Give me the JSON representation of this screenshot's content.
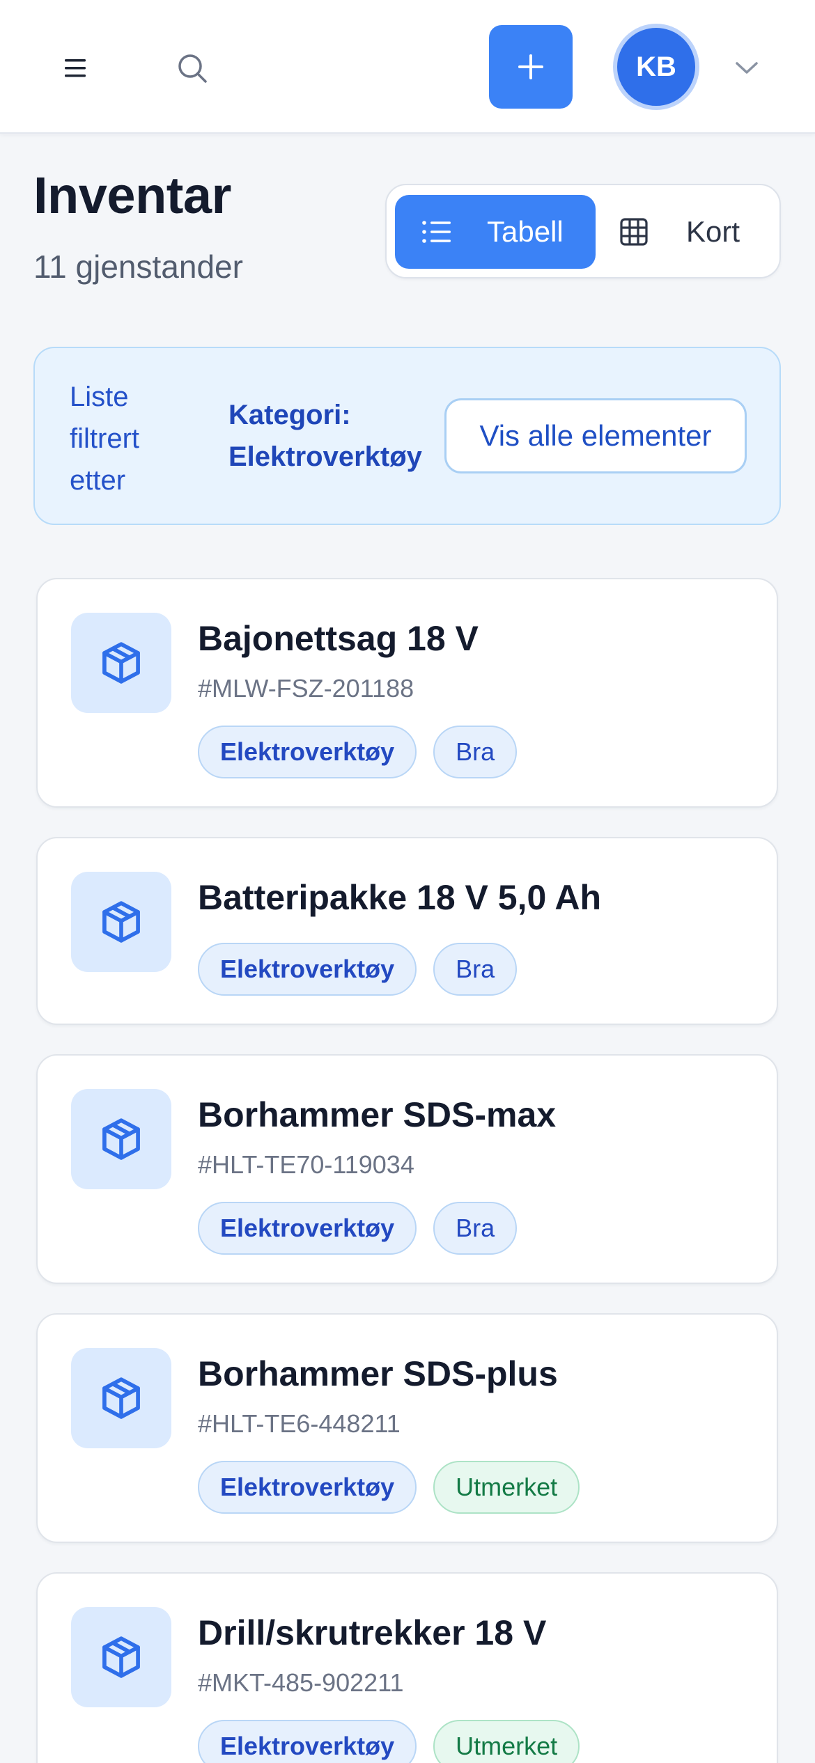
{
  "topbar": {
    "menu_icon": "hamburger-menu-icon",
    "search_icon": "search-icon",
    "add_icon": "plus-icon",
    "avatar_initials": "KB",
    "chevron_icon": "chevron-down-icon"
  },
  "header": {
    "title": "Inventar",
    "count_text": "11 gjenstander"
  },
  "view_toggle": {
    "table_label": "Tabell",
    "table_icon": "list-icon",
    "cards_label": "Kort",
    "cards_icon": "grid-icon",
    "active": "table"
  },
  "filter": {
    "prefix": "Liste filtrert etter",
    "value": "Kategori: Elektroverktøy",
    "show_all_label": "Vis alle elementer"
  },
  "items": [
    {
      "name": "Bajonettsag 18 V",
      "sku": "#MLW-FSZ-201188",
      "category": "Elektroverktøy",
      "condition": "Bra",
      "condition_style": "blue"
    },
    {
      "name": "Batteripakke 18 V 5,0 Ah",
      "sku": "",
      "category": "Elektroverktøy",
      "condition": "Bra",
      "condition_style": "blue"
    },
    {
      "name": "Borhammer SDS-max",
      "sku": "#HLT-TE70-119034",
      "category": "Elektroverktøy",
      "condition": "Bra",
      "condition_style": "blue"
    },
    {
      "name": "Borhammer SDS-plus",
      "sku": "#HLT-TE6-448211",
      "category": "Elektroverktøy",
      "condition": "Utmerket",
      "condition_style": "green"
    },
    {
      "name": "Drill/skrutrekker 18 V",
      "sku": "#MKT-485-902211",
      "category": "Elektroverktøy",
      "condition": "Utmerket",
      "condition_style": "green"
    }
  ],
  "item_icon": "package-box-icon",
  "colors": {
    "accent": "#3b82f6",
    "filter_bg": "#e8f3fe",
    "tag_blue_text": "#2349c1",
    "tag_green_text": "#137a45"
  }
}
